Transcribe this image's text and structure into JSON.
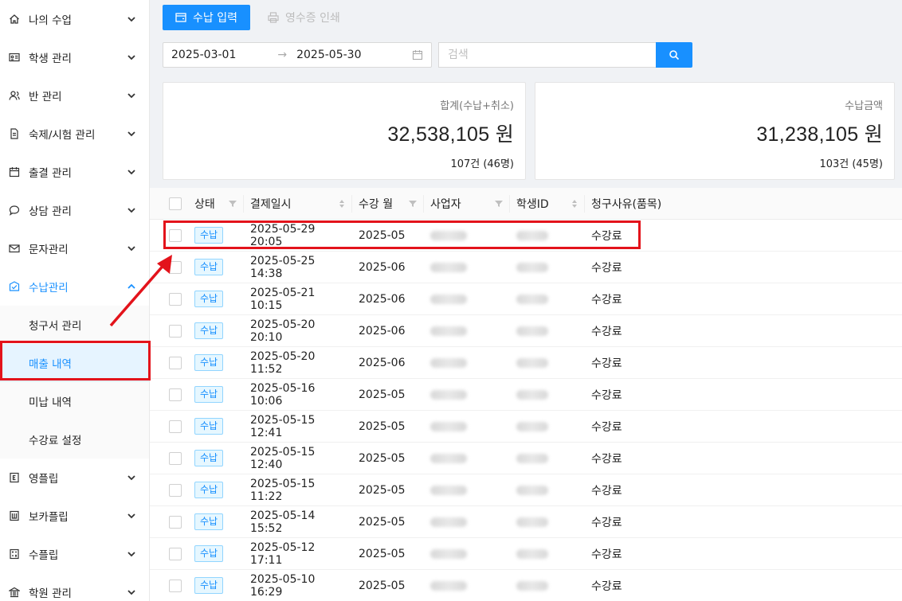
{
  "sidebar": {
    "items": [
      {
        "label": "나의 수업",
        "icon": "home-icon"
      },
      {
        "label": "학생 관리",
        "icon": "id-card-icon"
      },
      {
        "label": "반 관리",
        "icon": "users-icon"
      },
      {
        "label": "숙제/시험 관리",
        "icon": "document-icon"
      },
      {
        "label": "출결 관리",
        "icon": "calendar-icon"
      },
      {
        "label": "상담 관리",
        "icon": "chat-icon"
      },
      {
        "label": "문자관리",
        "icon": "mail-icon"
      },
      {
        "label": "수납관리",
        "icon": "payment-icon"
      }
    ],
    "payment_sub": [
      "청구서 관리",
      "매출 내역",
      "미납 내역",
      "수강료 설정"
    ],
    "bottom_items": [
      {
        "label": "영플립",
        "icon": "e-book-icon"
      },
      {
        "label": "보카플립",
        "icon": "book-icon"
      },
      {
        "label": "수플립",
        "icon": "calculator-icon"
      },
      {
        "label": "학원 관리",
        "icon": "building-icon"
      }
    ]
  },
  "toolbar": {
    "payment_input": "수납 입력",
    "print_receipt": "영수증 인쇄"
  },
  "filters": {
    "date_from": "2025-03-01",
    "date_to": "2025-05-30",
    "search_placeholder": "검색"
  },
  "summary": {
    "total": {
      "title": "합계(수납+취소)",
      "value": "32,538,105 원",
      "sub": "107건 (46명)"
    },
    "paid": {
      "title": "수납금액",
      "value": "31,238,105 원",
      "sub": "103건 (45명)"
    }
  },
  "table": {
    "headers": [
      "상태",
      "결제일시",
      "수강 월",
      "사업자",
      "학생ID",
      "청구사유(품목)"
    ],
    "rows": [
      {
        "status": "수납",
        "datetime": "2025-05-29 20:05",
        "month": "2025-05",
        "reason": "수강료"
      },
      {
        "status": "수납",
        "datetime": "2025-05-25 14:38",
        "month": "2025-06",
        "reason": "수강료"
      },
      {
        "status": "수납",
        "datetime": "2025-05-21 10:15",
        "month": "2025-06",
        "reason": "수강료"
      },
      {
        "status": "수납",
        "datetime": "2025-05-20 20:10",
        "month": "2025-06",
        "reason": "수강료"
      },
      {
        "status": "수납",
        "datetime": "2025-05-20 11:52",
        "month": "2025-06",
        "reason": "수강료"
      },
      {
        "status": "수납",
        "datetime": "2025-05-16 10:06",
        "month": "2025-05",
        "reason": "수강료"
      },
      {
        "status": "수납",
        "datetime": "2025-05-15 12:41",
        "month": "2025-05",
        "reason": "수강료"
      },
      {
        "status": "수납",
        "datetime": "2025-05-15 12:40",
        "month": "2025-05",
        "reason": "수강료"
      },
      {
        "status": "수납",
        "datetime": "2025-05-15 11:22",
        "month": "2025-05",
        "reason": "수강료"
      },
      {
        "status": "수납",
        "datetime": "2025-05-14 15:52",
        "month": "2025-05",
        "reason": "수강료"
      },
      {
        "status": "수납",
        "datetime": "2025-05-12 17:11",
        "month": "2025-05",
        "reason": "수강료"
      },
      {
        "status": "수납",
        "datetime": "2025-05-10 16:29",
        "month": "2025-05",
        "reason": "수강료"
      }
    ]
  },
  "colors": {
    "accent": "#1890ff",
    "annotation": "#e3131b"
  }
}
